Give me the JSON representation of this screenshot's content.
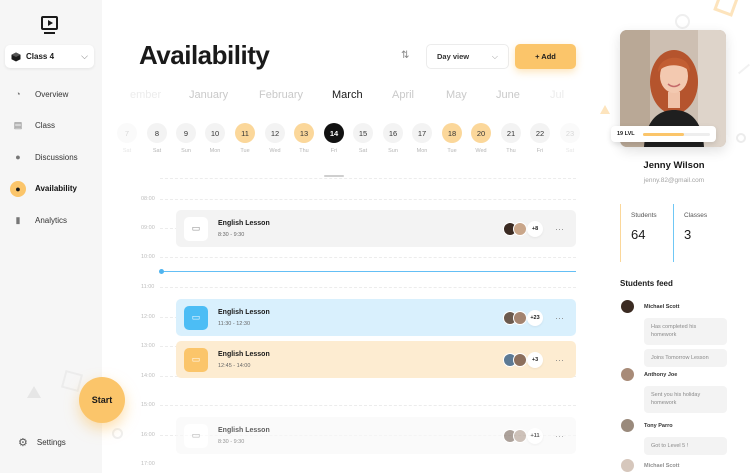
{
  "sidebar": {
    "class_selector": "Class 4",
    "nav": [
      {
        "label": "Overview",
        "icon": "pie-chart-icon"
      },
      {
        "label": "Class",
        "icon": "board-icon"
      },
      {
        "label": "Discussions",
        "icon": "chat-icon"
      },
      {
        "label": "Availability",
        "icon": "users-icon",
        "active": true
      },
      {
        "label": "Analytics",
        "icon": "bar-chart-icon"
      }
    ],
    "start_label": "Start",
    "settings_label": "Settings"
  },
  "header": {
    "title": "Availability",
    "view_select": "Day view",
    "add_label": "+ Add"
  },
  "months": [
    "ember",
    "January",
    "February",
    "March",
    "April",
    "May",
    "June",
    "Jul"
  ],
  "active_month": "March",
  "days": [
    {
      "num": "7",
      "name": "Sat"
    },
    {
      "num": "8",
      "name": "Sat"
    },
    {
      "num": "9",
      "name": "Sun"
    },
    {
      "num": "10",
      "name": "Mon"
    },
    {
      "num": "11",
      "name": "Tue"
    },
    {
      "num": "12",
      "name": "Wed"
    },
    {
      "num": "13",
      "name": "Thu"
    },
    {
      "num": "14",
      "name": "Fri"
    },
    {
      "num": "15",
      "name": "Sat"
    },
    {
      "num": "16",
      "name": "Sun"
    },
    {
      "num": "17",
      "name": "Mon"
    },
    {
      "num": "18",
      "name": "Tue"
    },
    {
      "num": "20",
      "name": "Wed"
    },
    {
      "num": "21",
      "name": "Thu"
    },
    {
      "num": "22",
      "name": "Fri"
    },
    {
      "num": "23",
      "name": "Sat"
    }
  ],
  "times": [
    "08:00",
    "09:00",
    "10:00",
    "11:00",
    "12:00",
    "13:00",
    "14:00",
    "15:00",
    "16:00",
    "17:00"
  ],
  "lessons": [
    {
      "name": "English Lesson",
      "time": "8:30 - 9:30",
      "more": "+8",
      "style": "gray"
    },
    {
      "name": "English Lesson",
      "time": "11:30 - 12:30",
      "more": "+23",
      "style": "blue"
    },
    {
      "name": "English Lesson",
      "time": "12:45 - 14:00",
      "more": "+3",
      "style": "orange"
    },
    {
      "name": "English Lesson",
      "time": "8:30 - 9:30",
      "more": "+11",
      "style": "fade"
    }
  ],
  "profile": {
    "level": "19 LVL",
    "level_progress": 0.62,
    "name": "Jenny Wilson",
    "email": "jenny.82@gmail.com",
    "stats": [
      {
        "label": "Students",
        "value": "64"
      },
      {
        "label": "Classes",
        "value": "3"
      }
    ]
  },
  "feed": {
    "title": "Students feed",
    "items": [
      {
        "name": "Michael Scott",
        "messages": [
          "Has completed his homework",
          "Joins Tomorrow Lesson"
        ]
      },
      {
        "name": "Anthony Joe",
        "messages": [
          "Sent you his holiday homework"
        ]
      },
      {
        "name": "Tony Parro",
        "messages": [
          "Got to Level 5 !"
        ]
      },
      {
        "name": "Michael Scott",
        "messages": []
      }
    ]
  },
  "colors": {
    "accent": "#fbc56a",
    "blue": "#4cbdf5",
    "sidebar_bg": "#f6f6f6"
  }
}
